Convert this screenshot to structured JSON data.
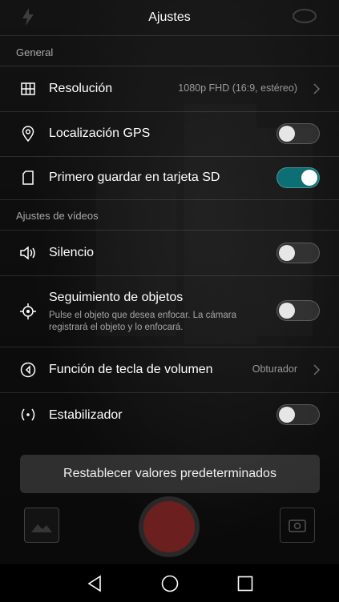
{
  "header": {
    "title": "Ajustes"
  },
  "sections": {
    "general": "General",
    "videos": "Ajustes de vídeos"
  },
  "rows": {
    "resolucion": {
      "label": "Resolución",
      "value": "1080p FHD (16:9, estéreo)",
      "icon": "grid-icon"
    },
    "gps": {
      "label": "Localización GPS",
      "toggle": false,
      "icon": "location-pin-icon"
    },
    "sd": {
      "label": "Primero guardar en tarjeta SD",
      "toggle": true,
      "icon": "sd-card-icon"
    },
    "silencio": {
      "label": "Silencio",
      "toggle": false,
      "icon": "speaker-mute-icon"
    },
    "seguimiento": {
      "label": "Seguimiento de objetos",
      "sub1": "Pulse el objeto que desea enfocar. La cámara",
      "sub2": "registrará el objeto y lo enfocará.",
      "toggle": false,
      "icon": "target-icon"
    },
    "volumen": {
      "label": "Función de tecla de volumen",
      "value": "Obturador",
      "icon": "volume-key-icon"
    },
    "estabilizador": {
      "label": "Estabilizador",
      "toggle": false,
      "icon": "stabilizer-icon"
    }
  },
  "reset": {
    "label": "Restablecer valores predeterminados"
  },
  "colors": {
    "accent": "#0d6f73",
    "shutter": "#6b1f1f"
  }
}
